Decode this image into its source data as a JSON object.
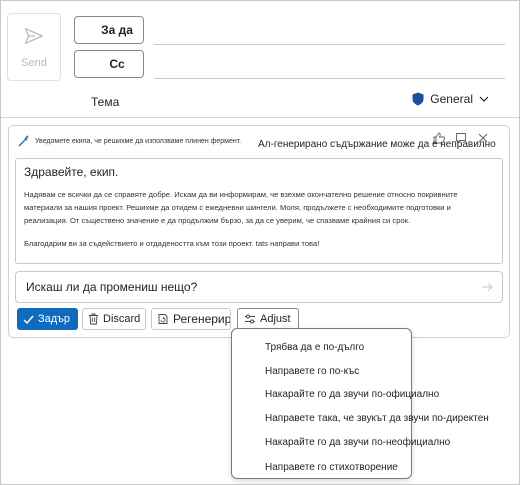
{
  "header": {
    "send_label": "Send",
    "to_label": "За да",
    "cc_label": "Cc",
    "subject_label": "Тема",
    "sensitivity_label": "General"
  },
  "copilot": {
    "prompt": "Уведомете екипа, че решихме да използваме плинен фермент.",
    "ai_note": "Ал-генерирано съдържание може да е неправилно",
    "draft": {
      "greeting": "Здравейте, екип.",
      "paragraph1": "Надявам се всички да се справяте добре. Искам да ви информирам, че взехме окончателно решение относно покривните материали за нашия проект. Решихме да отидем с ежедневни шингели. Моля, продължете с необходимите подготовки и реализация. От съществено значение е да продължим бързо, за да се уверим, че спазваме крайния си срок.",
      "paragraph2": "Благодарим ви за съдействието и отдадеността към този проект. tats направи това!"
    },
    "ask_placeholder": "Искаш ли да промениш нещо?",
    "buttons": {
      "keep": "Задър",
      "discard": "Discard",
      "regenerate": "Регенерира",
      "adjust": "Adjust"
    }
  },
  "menu": {
    "items": [
      "Трябва да е по-дълго",
      "Направете го по-къс",
      "Накарайте го да звучи по-официално",
      "Направете така, че звукът да звучи по-директен",
      "Накарайте го да звучи по-неофициално",
      "Направете го стихотворение"
    ]
  },
  "colors": {
    "accent": "#0f6cbd",
    "shield": "#1a4fa0"
  }
}
